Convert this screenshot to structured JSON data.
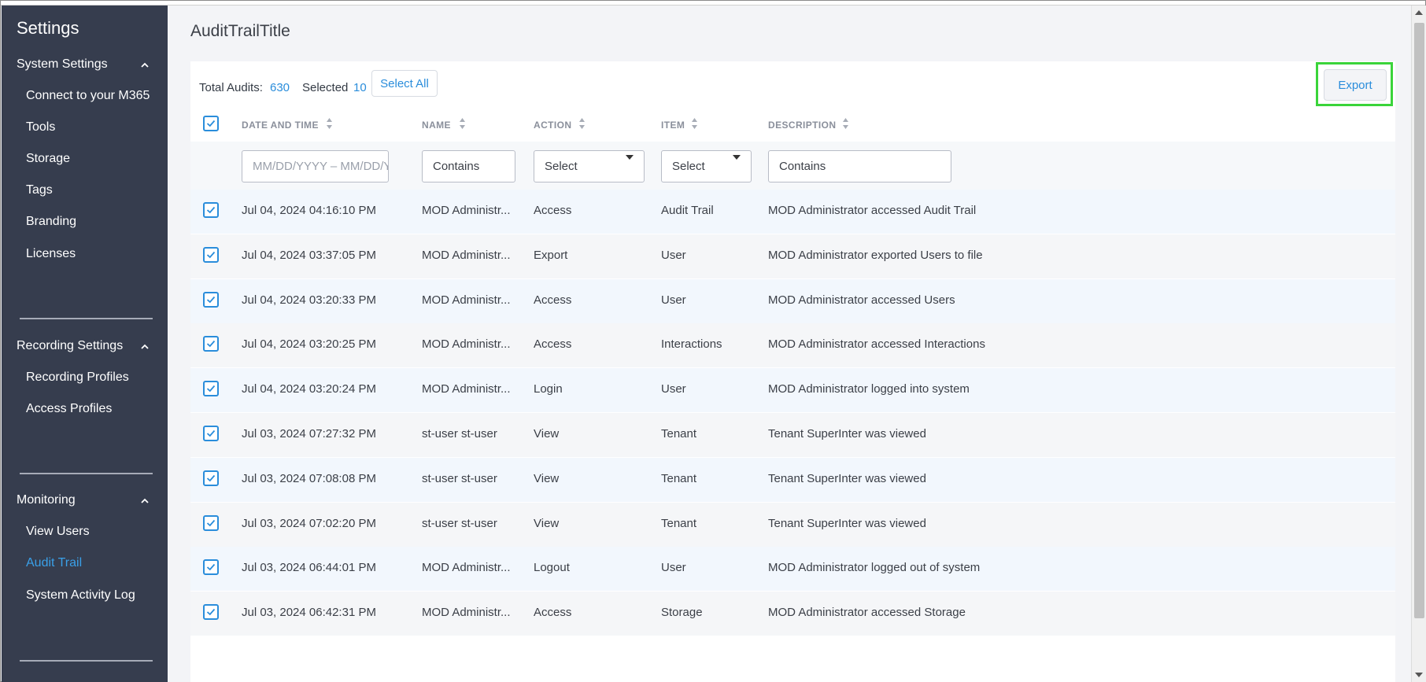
{
  "sidebar": {
    "title": "Settings",
    "sections": [
      {
        "label": "System Settings",
        "items": [
          "Connect to your M365",
          "Tools",
          "Storage",
          "Tags",
          "Branding",
          "Licenses"
        ]
      },
      {
        "label": "Recording Settings",
        "items": [
          "Recording Profiles",
          "Access Profiles"
        ]
      },
      {
        "label": "Monitoring",
        "items": [
          "View Users",
          "Audit Trail",
          "System Activity Log"
        ]
      }
    ],
    "active_item": "Audit Trail",
    "active_color": "#3aa0e8"
  },
  "page": {
    "title": "AuditTrailTitle"
  },
  "toolbar": {
    "total_label": "Total Audits:",
    "total_value": "630",
    "selected_label": "Selected",
    "selected_value": "10",
    "select_all_label": "Select All",
    "export_label": "Export"
  },
  "table": {
    "columns": [
      "DATE AND TIME",
      "NAME",
      "ACTION",
      "ITEM",
      "DESCRIPTION"
    ],
    "filters": {
      "date_placeholder": "MM/DD/YYYY – MM/DD/YYYY",
      "name_value": "Contains",
      "action_value": "Select",
      "item_value": "Select",
      "description_value": "Contains"
    },
    "rows": [
      {
        "date": "Jul 04, 2024 04:16:10 PM",
        "name": "MOD Administr...",
        "action": "Access",
        "item": "Audit Trail",
        "description": "MOD Administrator accessed Audit Trail"
      },
      {
        "date": "Jul 04, 2024 03:37:05 PM",
        "name": "MOD Administr...",
        "action": "Export",
        "item": "User",
        "description": "MOD Administrator exported Users to file"
      },
      {
        "date": "Jul 04, 2024 03:20:33 PM",
        "name": "MOD Administr...",
        "action": "Access",
        "item": "User",
        "description": "MOD Administrator accessed Users"
      },
      {
        "date": "Jul 04, 2024 03:20:25 PM",
        "name": "MOD Administr...",
        "action": "Access",
        "item": "Interactions",
        "description": "MOD Administrator accessed Interactions"
      },
      {
        "date": "Jul 04, 2024 03:20:24 PM",
        "name": "MOD Administr...",
        "action": "Login",
        "item": "User",
        "description": "MOD Administrator logged into system"
      },
      {
        "date": "Jul 03, 2024 07:27:32 PM",
        "name": "st-user st-user",
        "action": "View",
        "item": "Tenant",
        "description": "Tenant SuperInter was viewed"
      },
      {
        "date": "Jul 03, 2024 07:08:08 PM",
        "name": "st-user st-user",
        "action": "View",
        "item": "Tenant",
        "description": "Tenant SuperInter was viewed"
      },
      {
        "date": "Jul 03, 2024 07:02:20 PM",
        "name": "st-user st-user",
        "action": "View",
        "item": "Tenant",
        "description": "Tenant SuperInter was viewed"
      },
      {
        "date": "Jul 03, 2024 06:44:01 PM",
        "name": "MOD Administr...",
        "action": "Logout",
        "item": "User",
        "description": "MOD Administrator logged out of system"
      },
      {
        "date": "Jul 03, 2024 06:42:31 PM",
        "name": "MOD Administr...",
        "action": "Access",
        "item": "Storage",
        "description": "MOD Administrator accessed Storage"
      }
    ]
  },
  "colors": {
    "sidebar_bg": "#363d4e",
    "accent": "#2a8ddb",
    "highlight_frame": "#3ad43a",
    "row_alt_bg": "#f2f7fd"
  },
  "icons": [
    "chevron-up-icon",
    "sort-icon",
    "checkbox-checked-icon",
    "caret-down-icon",
    "scroll-up-arrow-icon",
    "scroll-down-arrow-icon"
  ]
}
